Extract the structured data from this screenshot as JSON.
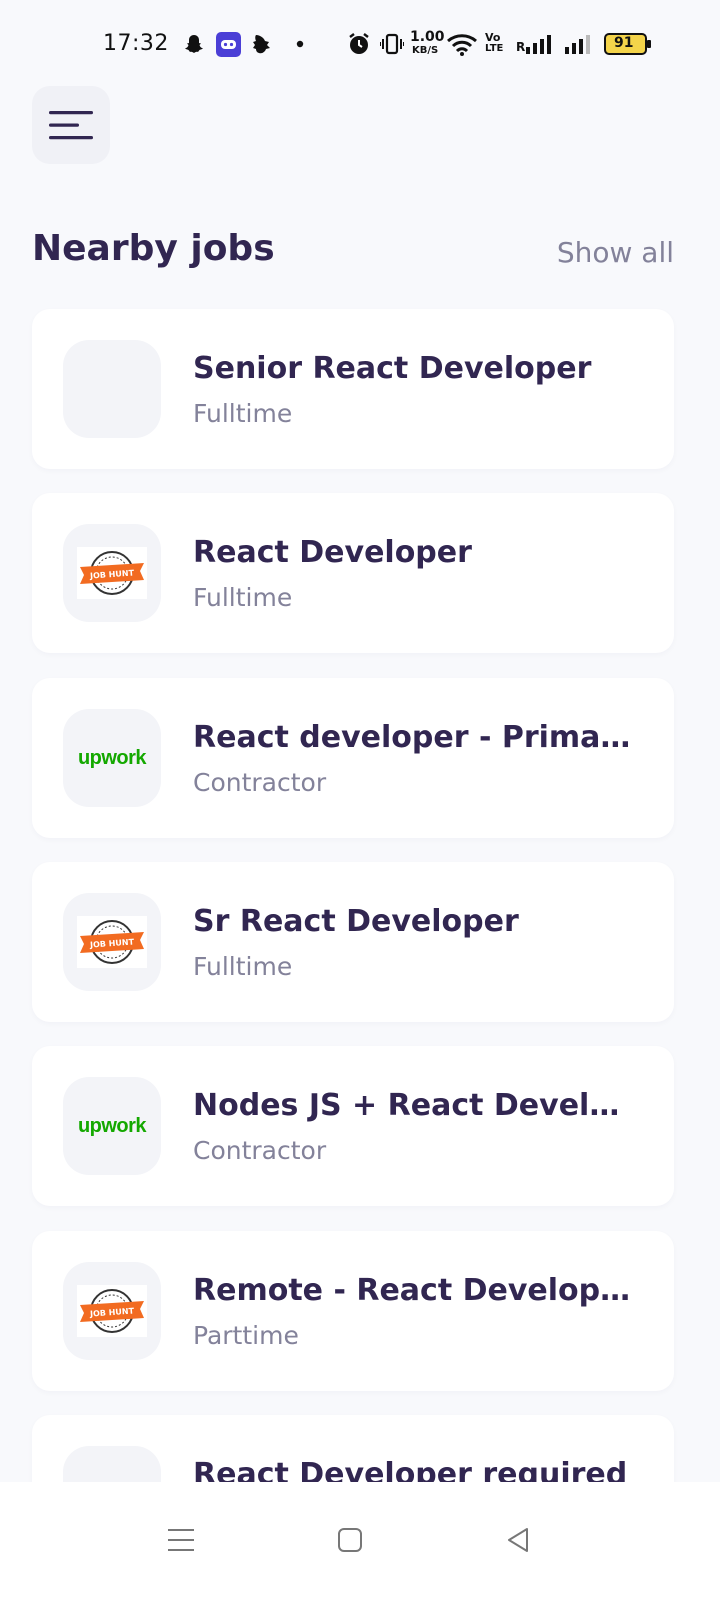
{
  "status_bar": {
    "time": "17:32",
    "network_speed": "1.00",
    "network_unit": "KB/S",
    "volte_top": "Vo",
    "volte_bottom": "LTE",
    "roaming": "R",
    "battery": "91",
    "icons": [
      "snapchat-icon",
      "game-app-icon",
      "notification-app-icon",
      "dot-icon",
      "alarm-icon",
      "vibrate-icon",
      "wifi-icon",
      "volte-icon",
      "signal-icon",
      "signal-icon-2",
      "battery-icon"
    ]
  },
  "header": {
    "menu_icon": "menu-icon"
  },
  "section": {
    "title": "Nearby jobs",
    "show_all": "Show all"
  },
  "logo_labels": {
    "upwork": "upwork",
    "jobhunt": "JOB HUNT"
  },
  "jobs": [
    {
      "title": "Senior React Developer",
      "type": "Fulltime",
      "logo": "blank"
    },
    {
      "title": "React Developer",
      "type": "Fulltime",
      "logo": "jobhunt"
    },
    {
      "title": "React developer - Primaril...",
      "type": "Contractor",
      "logo": "upwork"
    },
    {
      "title": "Sr React Developer",
      "type": "Fulltime",
      "logo": "jobhunt"
    },
    {
      "title": "Nodes JS + React Develop...",
      "type": "Contractor",
      "logo": "upwork"
    },
    {
      "title": "Remote - React Developer...",
      "type": "Parttime",
      "logo": "jobhunt"
    },
    {
      "title": "React Developer required",
      "type": "",
      "logo": "blank"
    }
  ],
  "nav": {
    "icons": [
      "recents-icon",
      "home-icon",
      "back-icon"
    ]
  },
  "colors": {
    "background": "#f8f9fc",
    "primary_text": "#312651",
    "secondary_text": "#83829a",
    "card": "#ffffff",
    "upwork_green": "#14a800",
    "jobhunt_orange": "#f26b21"
  }
}
